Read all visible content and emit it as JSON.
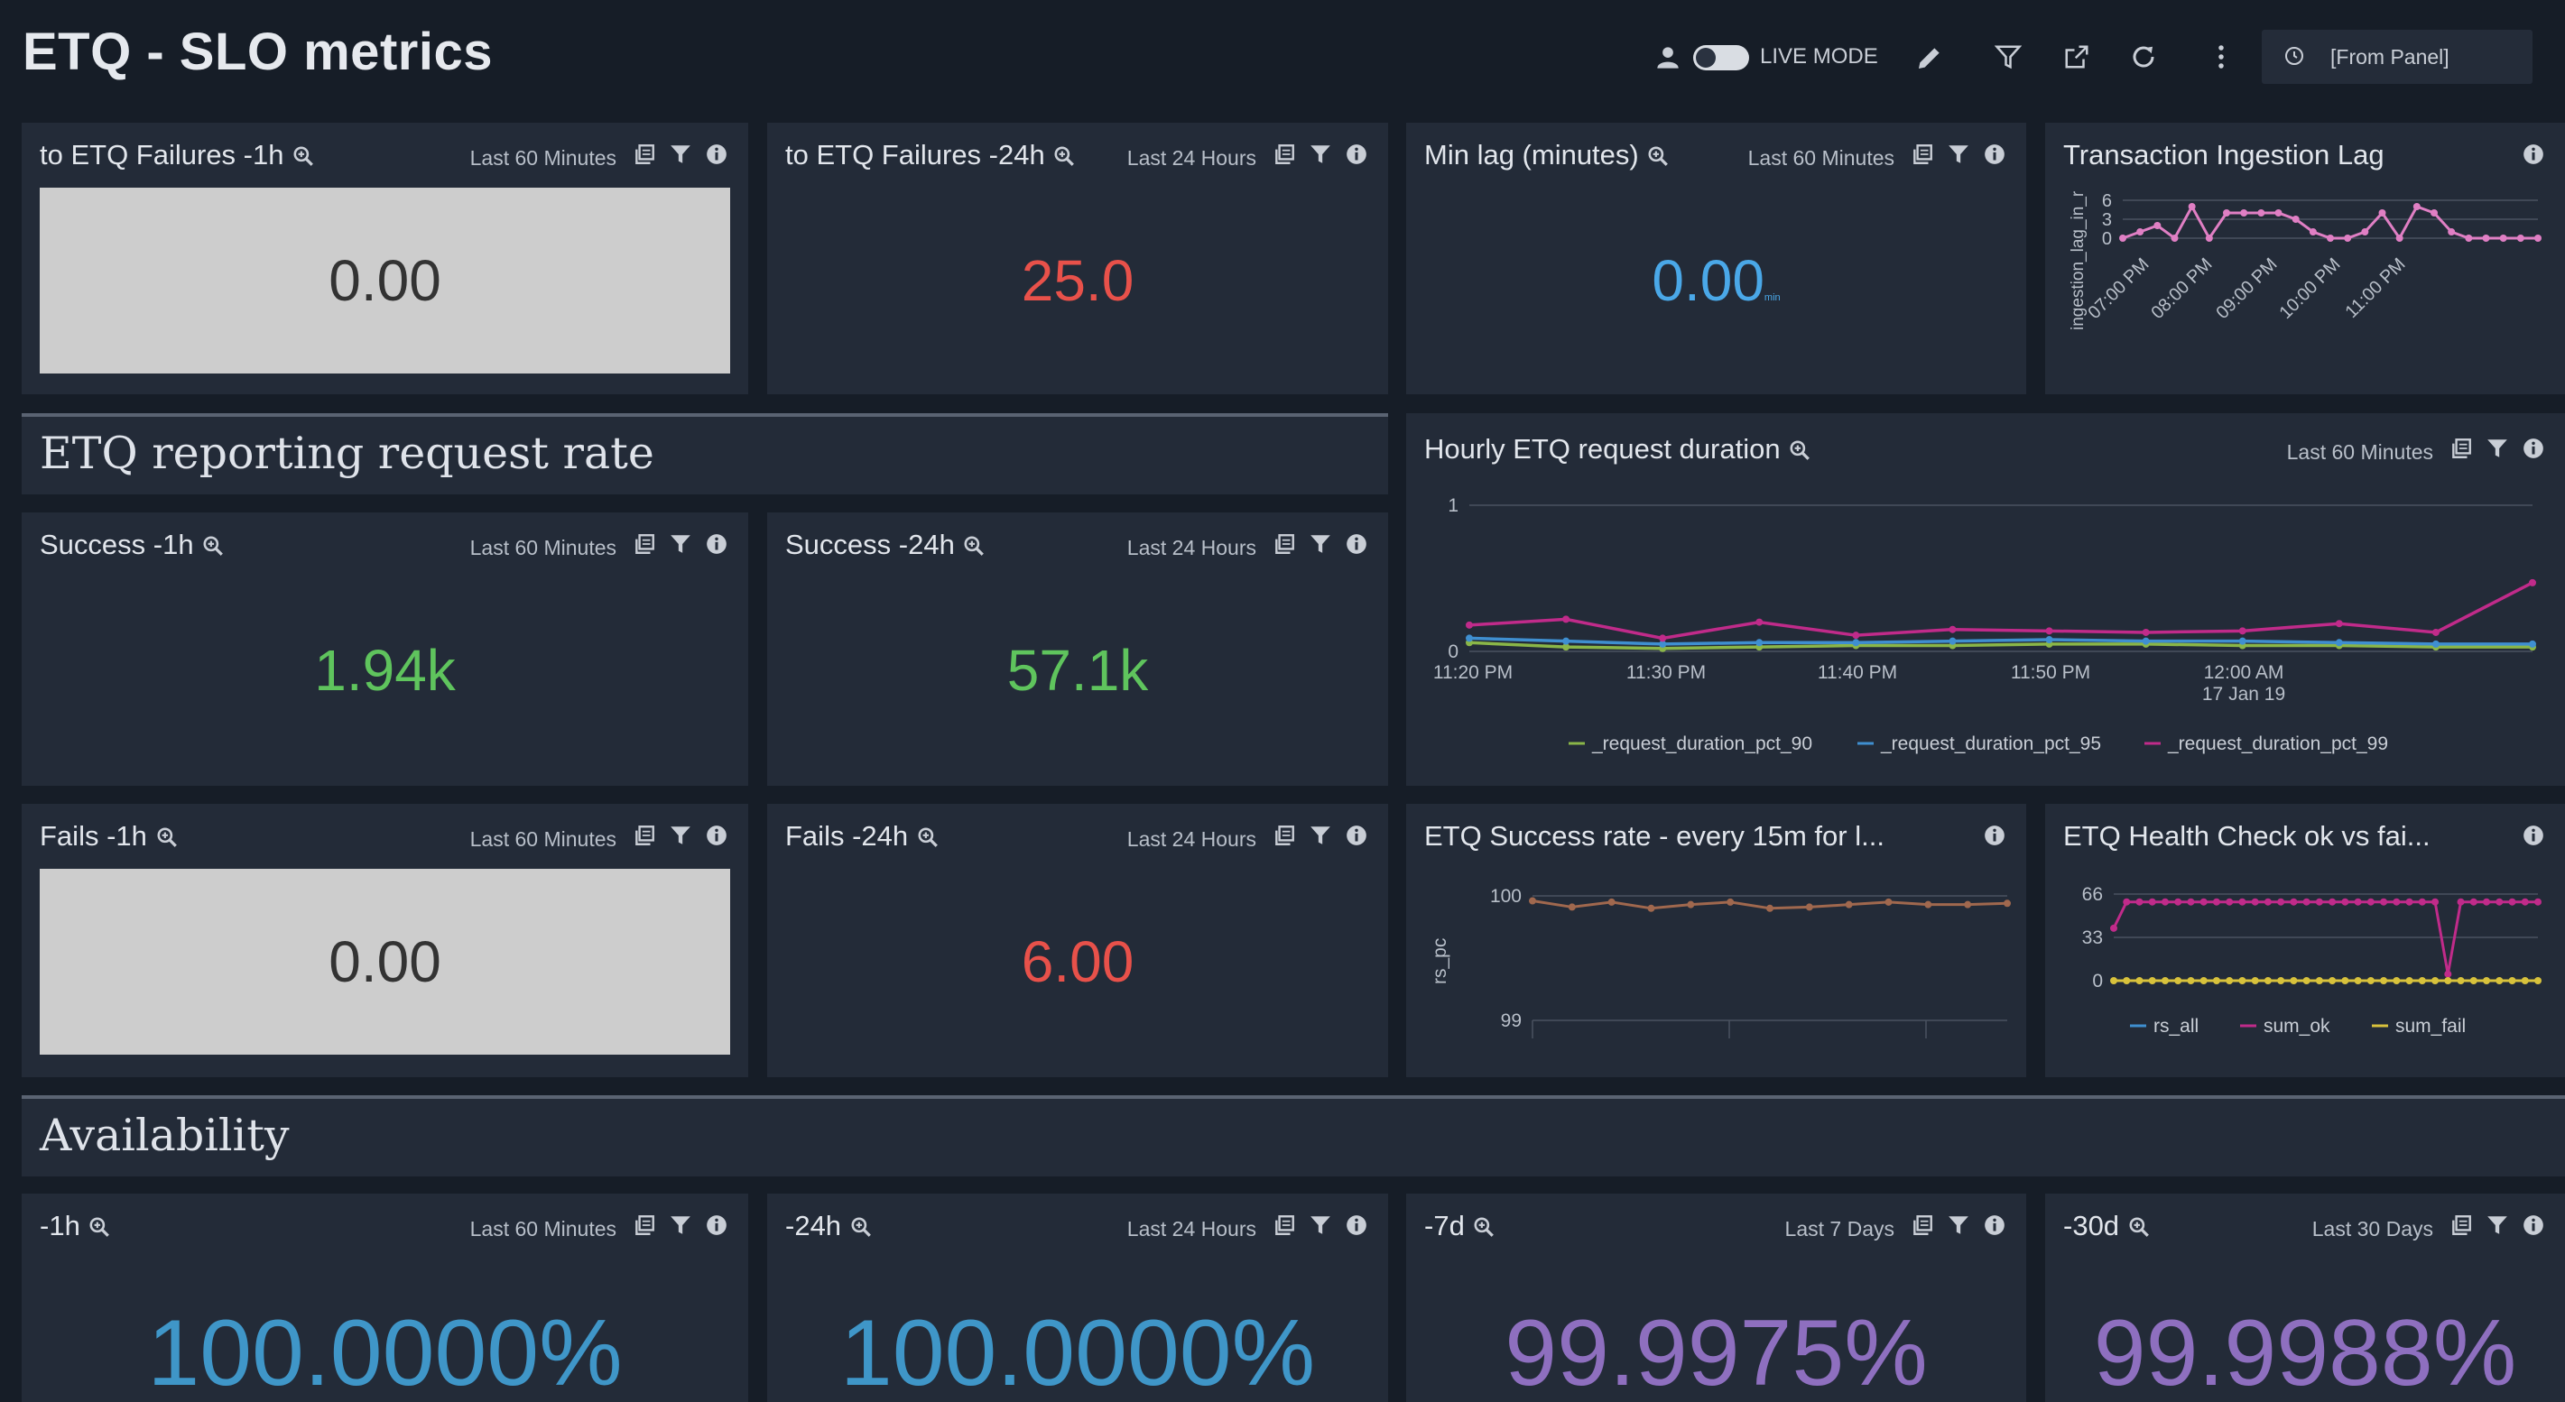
{
  "header": {
    "title": "ETQ - SLO metrics",
    "live_mode_label": "LIVE MODE",
    "time_range": "[From Panel]"
  },
  "panels": {
    "p1": {
      "title": "to ETQ Failures -1h",
      "range": "Last 60 Minutes",
      "value": "0.00"
    },
    "p2": {
      "title": "to ETQ Failures -24h",
      "range": "Last 24 Hours",
      "value": "25.0"
    },
    "p3": {
      "title": "Min lag (minutes)",
      "range": "Last 60 Minutes",
      "value": "0.00",
      "unit": "min"
    },
    "p4": {
      "title": "Transaction Ingestion Lag"
    },
    "p5": {
      "title": "Success -1h",
      "range": "Last 60 Minutes",
      "value": "1.94k"
    },
    "p6": {
      "title": "Success -24h",
      "range": "Last 24 Hours",
      "value": "57.1k"
    },
    "p7": {
      "title": "Hourly ETQ request duration",
      "range": "Last 60 Minutes"
    },
    "p8": {
      "title": "Fails -1h",
      "range": "Last 60 Minutes",
      "value": "0.00"
    },
    "p9": {
      "title": "Fails -24h",
      "range": "Last 24 Hours",
      "value": "6.00"
    },
    "p10": {
      "title": "ETQ Success rate - every 15m for l..."
    },
    "p11": {
      "title": "ETQ Health Check ok vs fai..."
    },
    "p12": {
      "title": "-1h",
      "range": "Last 60 Minutes",
      "value": "100.0000%"
    },
    "p13": {
      "title": "-24h",
      "range": "Last 24 Hours",
      "value": "100.0000%"
    },
    "p14": {
      "title": "-7d",
      "range": "Last 7 Days",
      "value": "99.9975%"
    },
    "p15": {
      "title": "-30d",
      "range": "Last 30 Days",
      "value": "99.9988%"
    }
  },
  "sections": {
    "s1": "ETQ reporting request rate",
    "s2": "Availability"
  },
  "colors": {
    "red": "#e8514a",
    "green": "#5fc45d",
    "blue": "#4aa8e8",
    "teal": "#3f96c8",
    "purple": "#8e6fbf",
    "dark_text": "#333333"
  },
  "icons": [
    "user-icon",
    "pencil-icon",
    "filter-icon",
    "share-icon",
    "refresh-icon",
    "more-vertical-icon",
    "clock-icon",
    "zoom-icon",
    "copy-icon",
    "info-icon"
  ],
  "chart_data": [
    {
      "id": "ingestion_lag",
      "type": "line",
      "ylabel": "ingestion_lag_in_r",
      "yticks": [
        "6",
        "3",
        "0"
      ],
      "ylim": [
        0,
        6
      ],
      "xticks": [
        "07:00 PM",
        "08:00 PM",
        "09:00 PM",
        "10:00 PM",
        "11:00 PM"
      ],
      "series": [
        {
          "color": "#e07fc4",
          "values": [
            0,
            1,
            2,
            0,
            5,
            0,
            4,
            4,
            4,
            4,
            3,
            1,
            0,
            0,
            1,
            4,
            0,
            5,
            4,
            1,
            0,
            0,
            0,
            0,
            0
          ]
        }
      ]
    },
    {
      "id": "request_duration",
      "type": "line",
      "yticks": [
        "1",
        "0"
      ],
      "ylim": [
        0,
        1
      ],
      "xticks": [
        "11:20 PM",
        "11:30 PM",
        "11:40 PM",
        "11:50 PM",
        "12:00 AM"
      ],
      "xticks_sub": [
        "",
        "",
        "",
        "",
        "17 Jan 19"
      ],
      "series": [
        {
          "name": "_request_duration_pct_90",
          "color": "#8ab648",
          "values": [
            0.06,
            0.03,
            0.02,
            0.03,
            0.04,
            0.04,
            0.05,
            0.05,
            0.04,
            0.04,
            0.03,
            0.03
          ]
        },
        {
          "name": "_request_duration_pct_95",
          "color": "#3f8fd0",
          "values": [
            0.09,
            0.07,
            0.05,
            0.06,
            0.06,
            0.07,
            0.08,
            0.07,
            0.07,
            0.06,
            0.05,
            0.05
          ]
        },
        {
          "name": "_request_duration_pct_99",
          "color": "#c02b8a",
          "values": [
            0.18,
            0.22,
            0.09,
            0.2,
            0.11,
            0.15,
            0.14,
            0.13,
            0.14,
            0.19,
            0.13,
            0.47
          ]
        }
      ]
    },
    {
      "id": "success_rate",
      "type": "line",
      "ylabel": "rs_pc",
      "yticks": [
        "100",
        "99"
      ],
      "ylim": [
        99,
        100
      ],
      "series": [
        {
          "color": "#a0684e",
          "values": [
            99.96,
            99.91,
            99.95,
            99.9,
            99.93,
            99.95,
            99.9,
            99.91,
            99.93,
            99.95,
            99.93,
            99.93,
            99.94
          ]
        }
      ]
    },
    {
      "id": "health_check",
      "type": "line",
      "yticks": [
        "66",
        "33",
        "0"
      ],
      "ylim": [
        0,
        66
      ],
      "series": [
        {
          "name": "rs_all",
          "color": "#3f8fd0",
          "values": []
        },
        {
          "name": "sum_ok",
          "color": "#c02b8a",
          "values": [
            40,
            60,
            60,
            60,
            60,
            60,
            60,
            60,
            60,
            60,
            60,
            60,
            60,
            60,
            60,
            60,
            60,
            60,
            60,
            60,
            60,
            60,
            60,
            60,
            60,
            60,
            5,
            60,
            60,
            60,
            60,
            60,
            60,
            60
          ]
        },
        {
          "name": "sum_fail",
          "color": "#d8c23c",
          "values": [
            0,
            0,
            0,
            0,
            0,
            0,
            0,
            0,
            0,
            0,
            0,
            0,
            0,
            0,
            0,
            0,
            0,
            0,
            0,
            0,
            0,
            0,
            0,
            0,
            0,
            0,
            0,
            0,
            0,
            0,
            0,
            0,
            0,
            0
          ]
        }
      ]
    }
  ]
}
